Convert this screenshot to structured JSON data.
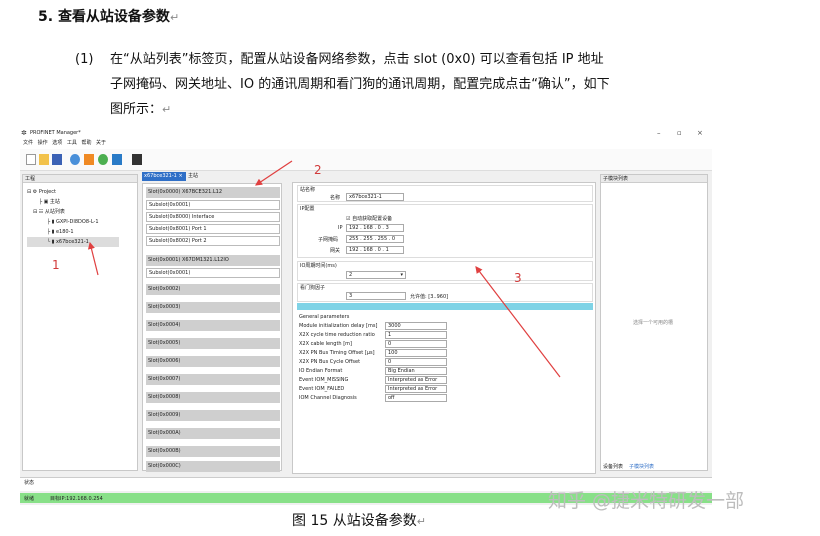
{
  "heading": {
    "number": "5.",
    "title": "查看从站设备参数",
    "mark": "↵"
  },
  "paragraph": {
    "num": "(1)",
    "lines": [
      "在“从站列表”标签页，配置从站设备网络参数，点击 slot (0x0) 可以查看包括 IP 地址",
      "子网掩码、网关地址、IO 的通讯周期和看门狗的通讯周期，配置完成点击“确认”，如下",
      "图所示："
    ],
    "mark": "↵"
  },
  "caption": {
    "text": "图 15 从站设备参数",
    "mark": "↵"
  },
  "watermark": "知乎 @捷米特研发一部",
  "annotations": [
    "1",
    "2",
    "3"
  ],
  "screenshot": {
    "title": "PROFINET Manager*",
    "menu": [
      "文件",
      "操作",
      "选项",
      "工具",
      "帮助",
      "关于"
    ],
    "left_panel_header": "工程",
    "tree": [
      "Project",
      "主站",
      "从站列表",
      "GXPI-DI8DO8-L-1",
      "e180-1",
      "x67bce321-1"
    ],
    "tabs": [
      "x67bce321-1",
      "主站"
    ],
    "slots": [
      {
        "label": "Slot(0x0000)  X67BCE321.L12",
        "subs": [
          "Subslot(0x0001)",
          "Subslot(0x8000)  Interface",
          "Subslot(0x8001)  Port 1",
          "Subslot(0x8002)  Port 2"
        ]
      },
      {
        "label": "Slot(0x0001)  X67DM1321.L12IO",
        "subs": [
          "Subslot(0x0001)"
        ]
      },
      {
        "label": "Slot(0x0002)",
        "subs": []
      },
      {
        "label": "Slot(0x0003)",
        "subs": []
      },
      {
        "label": "Slot(0x0004)",
        "subs": []
      },
      {
        "label": "Slot(0x0005)",
        "subs": []
      },
      {
        "label": "Slot(0x0006)",
        "subs": []
      },
      {
        "label": "Slot(0x0007)",
        "subs": []
      },
      {
        "label": "Slot(0x0008)",
        "subs": []
      },
      {
        "label": "Slot(0x0009)",
        "subs": []
      },
      {
        "label": "Slot(0x000A)",
        "subs": []
      },
      {
        "label": "Slot(0x000B)",
        "subs": []
      },
      {
        "label": "Slot(0x000C)",
        "subs": []
      }
    ],
    "config": {
      "station_name_group": "站名称",
      "name_label": "名称",
      "name_value": "x67bce321-1",
      "ip_group": "IP配置",
      "auto_ip": "自动获取配置设备",
      "ip_label": "IP",
      "ip_value": "192 . 168 . 0 . 3",
      "mask_label": "子网掩码",
      "mask_value": "255 . 255 . 255 . 0",
      "gw_label": "网关",
      "gw_value": "192 . 168 . 0 . 1",
      "io_cycle_group": "IO周期时间(ms)",
      "io_cycle_value": "2",
      "watchdog_group": "看门狗因子",
      "watchdog_value": "3",
      "watchdog_range": "允许值: [3..960]",
      "general": "General parameters",
      "params": [
        {
          "name": "Module initialization delay [ms]",
          "value": "3000"
        },
        {
          "name": "X2X cycle time reduction ratio",
          "value": "1"
        },
        {
          "name": "X2X cable length [m]",
          "value": "0"
        },
        {
          "name": "X2X PN Bus Timing Offset [μs]",
          "value": "100"
        },
        {
          "name": "X2X PN Bus Cycle Offset",
          "value": "0"
        },
        {
          "name": "IO Endian Format",
          "value": "Big Endian"
        },
        {
          "name": "Event IOM_MISSING",
          "value": "Interpreted as Error"
        },
        {
          "name": "Event IOM_FAILED",
          "value": "Interpreted as Error"
        },
        {
          "name": "IOM Channel Diagnosis",
          "value": "off"
        }
      ]
    },
    "right_panel_header": "子模块列表",
    "right_panel_hint": "选择一个可用的槽",
    "right_tabs": [
      "设备列表",
      "子模块列表"
    ],
    "status_header": "状态",
    "status_left": "就绪",
    "status_ip": "目标IP:192.168.0.254"
  }
}
